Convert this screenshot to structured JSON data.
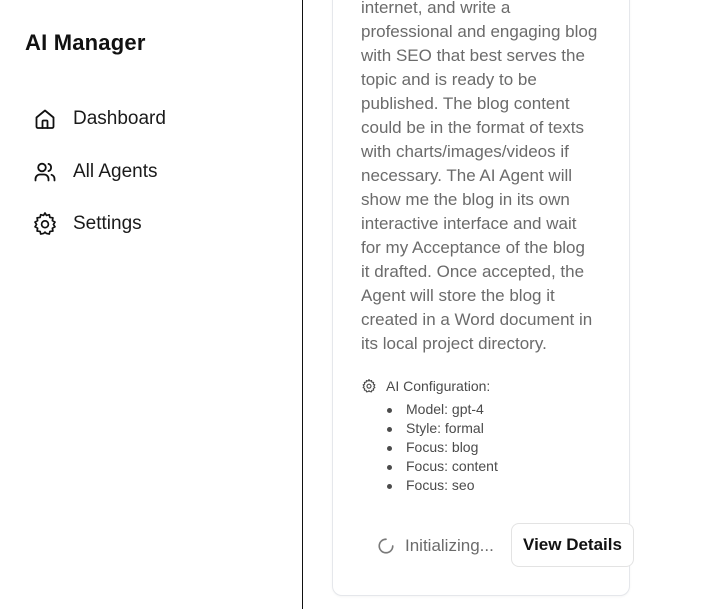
{
  "sidebar": {
    "title": "AI Manager",
    "items": [
      {
        "label": "Dashboard",
        "icon": "home-icon"
      },
      {
        "label": "All Agents",
        "icon": "users-icon"
      },
      {
        "label": "Settings",
        "icon": "gear-icon"
      }
    ]
  },
  "agent_card": {
    "description_lines": [
      "internet, and write a",
      "professional and engaging blog",
      "with SEO that best serves the",
      "topic and is ready to be",
      "published. The blog content",
      "could be in the format of texts",
      "with charts/images/videos if",
      "necessary. The AI Agent will",
      "show me the blog in its own",
      "interactive interface and wait",
      "for my Acceptance of the blog",
      "it drafted. Once accepted, the",
      "Agent will store the blog it",
      "created in a Word document in",
      "its local project directory."
    ],
    "config": {
      "title": "AI Configuration:",
      "icon": "gear-icon",
      "items": [
        "Model: gpt-4",
        "Style: formal",
        "Focus: blog",
        "Focus: content",
        "Focus: seo"
      ]
    },
    "status": {
      "text": "Initializing...",
      "icon": "spinner-icon"
    },
    "details_button": "View Details"
  },
  "colors": {
    "text_primary": "#111111",
    "text_muted": "#6b6b6b",
    "card_border": "#e5e7eb",
    "sidebar_border": "#111111"
  }
}
